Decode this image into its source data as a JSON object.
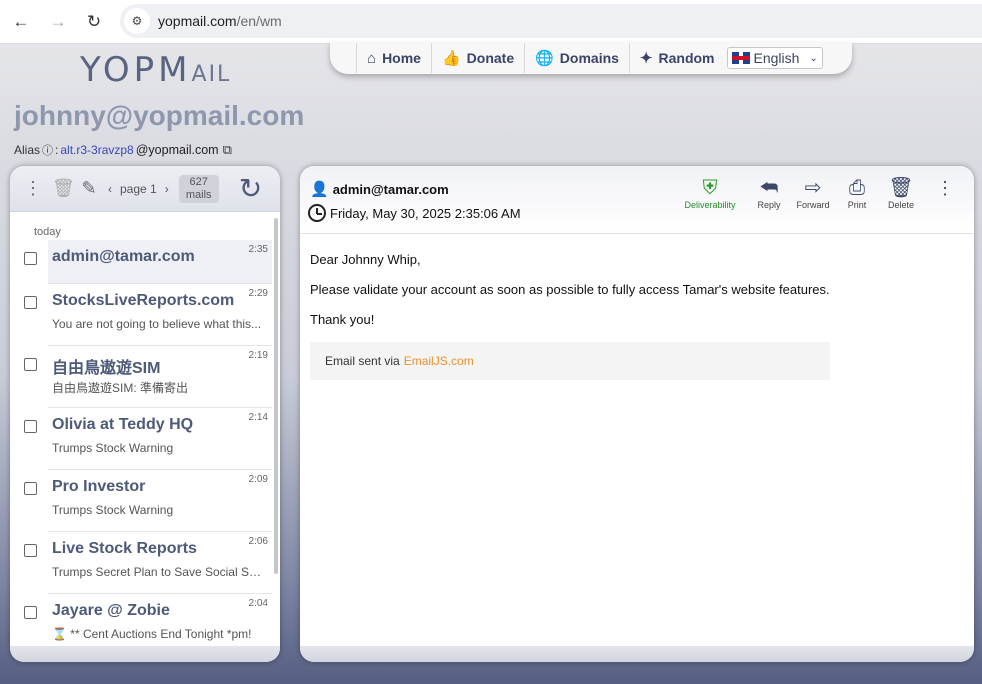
{
  "browser": {
    "url_host": "yopmail.com",
    "url_path": "/en/wm",
    "back_icon": "arrow-left-icon",
    "forward_icon": "arrow-right-icon",
    "reload_icon": "reload-icon"
  },
  "header": {
    "logo_main": "YOPM",
    "logo_small": "AIL",
    "nav": [
      {
        "label": "Home",
        "icon": "home-icon"
      },
      {
        "label": "Donate",
        "icon": "thumbs-up-icon"
      },
      {
        "label": "Domains",
        "icon": "globe-icon"
      },
      {
        "label": "Random",
        "icon": "magic-wand-icon"
      }
    ],
    "language": "English"
  },
  "mailbox": {
    "address": "johnny@yopmail.com",
    "alias_label": "Alias",
    "alias_sep": ":",
    "alias_value": "alt.r3-3ravzp8",
    "alias_domain": "@yopmail.com"
  },
  "inbox": {
    "page_label": "page 1",
    "count": "627",
    "count_unit": "mails",
    "day_label": "today",
    "items": [
      {
        "sender": "admin@tamar.com",
        "time": "2:35",
        "preview": ""
      },
      {
        "sender": "StocksLiveReports.com",
        "time": "2:29",
        "preview": "You are not going to believe what this..."
      },
      {
        "sender": "自由鳥遨遊SIM",
        "time": "2:19",
        "preview": "自由鳥遨遊SIM: 準備寄出"
      },
      {
        "sender": "Olivia at Teddy HQ",
        "time": "2:14",
        "preview": "Trumps Stock Warning"
      },
      {
        "sender": "Pro Investor",
        "time": "2:09",
        "preview": "Trumps Stock Warning"
      },
      {
        "sender": "Live Stock Reports",
        "time": "2:06",
        "preview": "Trumps Secret Plan to Save Social Security"
      },
      {
        "sender": "Jayare @ Zobie",
        "time": "2:04",
        "preview": "⌛ ** Cent Auctions End Tonight *pm!"
      }
    ]
  },
  "mail": {
    "from": "admin@tamar.com",
    "date": "Friday, May 30, 2025 2:35:06 AM",
    "actions": {
      "deliverability": "Deliverability",
      "reply": "Reply",
      "forward": "Forward",
      "print": "Print",
      "delete": "Delete"
    },
    "body": {
      "greeting": "Dear Johnny Whip,",
      "line1": "Please validate your account as soon as possible to fully access Tamar's website features.",
      "line2": "Thank you!",
      "footer_prefix": "Email sent via",
      "footer_link": "EmailJS.com"
    }
  }
}
